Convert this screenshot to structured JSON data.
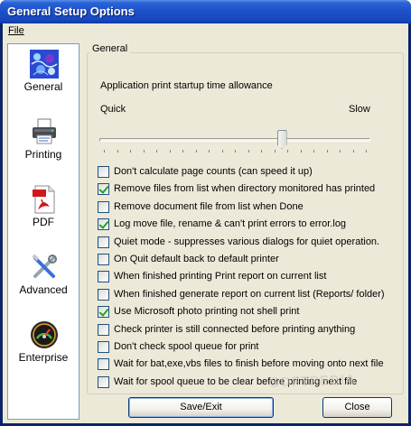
{
  "window": {
    "title": "General Setup Options"
  },
  "menu": {
    "file": "File"
  },
  "nav": {
    "items": [
      {
        "label": "General",
        "icon": "general-pattern-icon"
      },
      {
        "label": "Printing",
        "icon": "printer-icon"
      },
      {
        "label": "PDF",
        "icon": "pdf-document-icon"
      },
      {
        "label": "Advanced",
        "icon": "tools-icon"
      },
      {
        "label": "Enterprise",
        "icon": "gauge-icon"
      }
    ]
  },
  "general": {
    "group_title": "General",
    "startup_label": "Application print startup time allowance",
    "quick_label": "Quick",
    "slow_label": "Slow",
    "slider_position_fraction": 0.68
  },
  "options": [
    {
      "label": "Don't calculate page counts (can speed it up)",
      "checked": false
    },
    {
      "label": "Remove files from list when directory monitored has printed",
      "checked": true
    },
    {
      "label": "Remove document file from list when Done",
      "checked": false
    },
    {
      "label": "Log move file, rename & can't print errors to error.log",
      "checked": true
    },
    {
      "label": "Quiet mode - suppresses various dialogs for quiet operation.",
      "checked": false
    },
    {
      "label": "On Quit default back to default printer",
      "checked": false
    },
    {
      "label": "When finished printing Print report on current list",
      "checked": false
    },
    {
      "label": "When finished generate report on current list (Reports/ folder)",
      "checked": false
    },
    {
      "label": "Use Microsoft photo printing not shell print",
      "checked": true
    },
    {
      "label": "Check printer is still connected before printing anything",
      "checked": false
    },
    {
      "label": "Don't check spool queue for print",
      "checked": false
    },
    {
      "label": "Wait for bat,exe,vbs files to finish before moving onto next file",
      "checked": false
    },
    {
      "label": "Wait for spool queue to be clear before printing next file",
      "checked": false
    }
  ],
  "buttons": {
    "save": "Save/Exit",
    "close": "Close"
  },
  "watermark": "SOFTPEDIA",
  "colors": {
    "titlebar": "#1c4fc8",
    "dialog": "#ece9d8",
    "checkmark": "#21a121"
  }
}
